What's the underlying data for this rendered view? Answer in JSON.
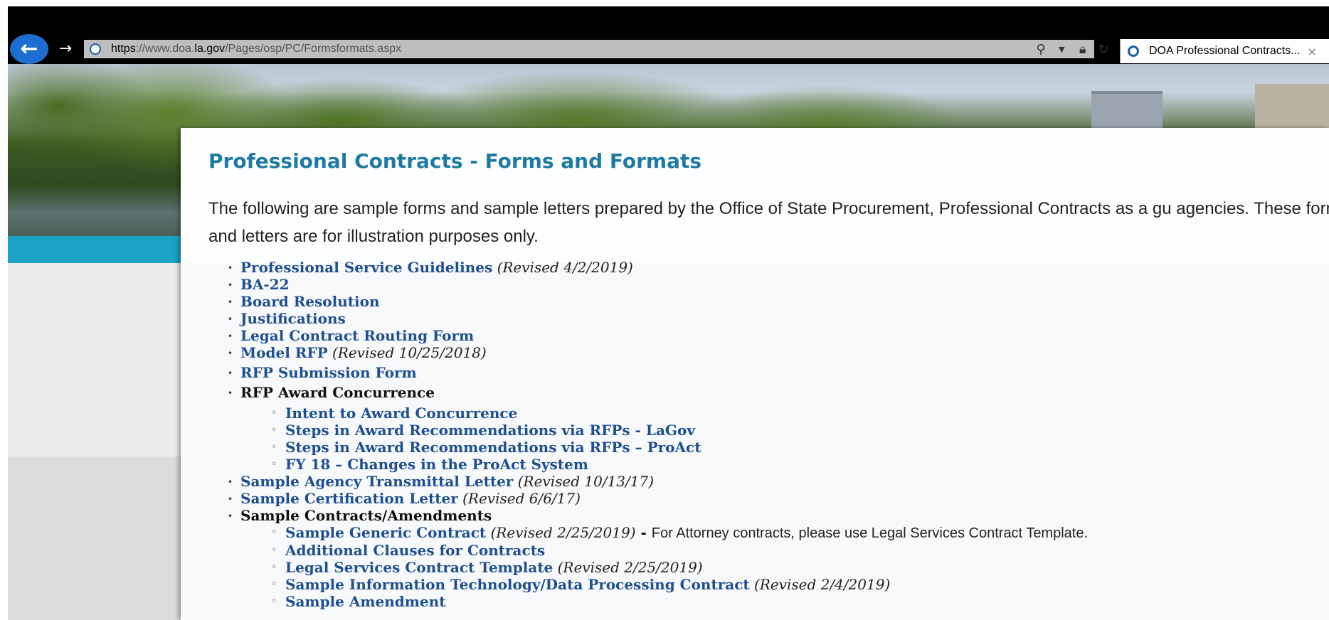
{
  "browser": {
    "url_scheme": "https",
    "url_prefix": "://www.doa.",
    "url_host": "la.gov",
    "url_path": "/Pages/osp/PC/Formsformats.aspx",
    "tab_title": "DOA Professional Contracts...",
    "tab_close": "×",
    "back_glyph": "←",
    "forward_glyph": "→"
  },
  "page": {
    "title": "Professional Contracts - Forms and Formats",
    "intro": "The following are sample forms and sample letters prepared by the Office of State Procurement, Professional Contracts as a gu agencies.  These forms and letters are for illustration purposes only."
  },
  "items": [
    {
      "label": "Professional Service Guidelines",
      "revised": "(Revised 4/2/2019)"
    },
    {
      "label": "BA-22"
    },
    {
      "label": "Board Resolution"
    },
    {
      "label": "Justifications"
    },
    {
      "label": "Legal Contract Routing Form"
    },
    {
      "label": "Model RFP",
      "revised": "(Revised 10/25/2018)"
    },
    {
      "label": "RFP Submission Form"
    },
    {
      "label": "RFP Award Concurrence"
    },
    {
      "label": "Intent to Award Concurrence"
    },
    {
      "label": "Steps in Award Recommendations via RFPs - LaGov"
    },
    {
      "label": "Steps in Award Recommendations via RFPs – ProAct"
    },
    {
      "label": "FY 18 – Changes in the ProAct System"
    },
    {
      "label": "Sample Agency Transmittal Letter",
      "revised": "(Revised 10/13/17)"
    },
    {
      "label": "Sample Certification Letter",
      "revised": "(Revised 6/6/17)"
    },
    {
      "label": "Sample Contracts/Amendments"
    },
    {
      "label": "Sample Generic Contract",
      "revised": "(Revised 2/25/2019)",
      "dash": " - ",
      "note": "For Attorney contracts, please use Legal Services Contract Template."
    },
    {
      "label": "Additional Clauses for Contracts"
    },
    {
      "label": "Legal Services Contract Template",
      "revised": "(Revised 2/25/2019)"
    },
    {
      "label": "Sample Information Technology/Data Processing Contract",
      "revised": "(Revised 2/4/2019)"
    },
    {
      "label": "Sample Amendment"
    }
  ]
}
